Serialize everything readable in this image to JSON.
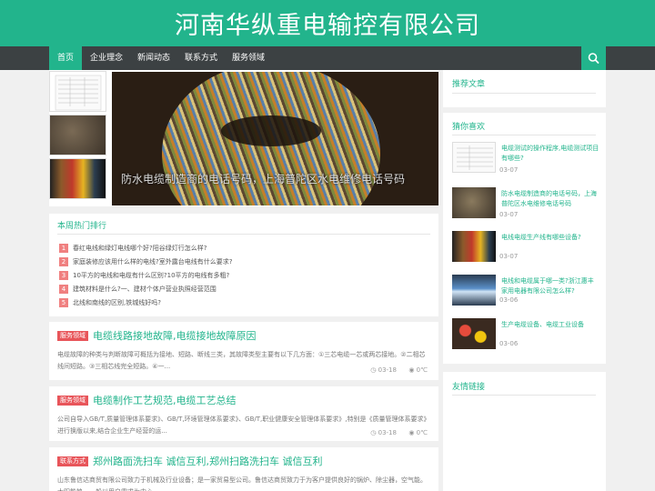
{
  "site": {
    "title": "河南华纵重电输控有限公司"
  },
  "nav": {
    "items": [
      "首页",
      "企业理念",
      "新闻动态",
      "联系方式",
      "服务领域"
    ],
    "search_icon": "search-icon"
  },
  "slider": {
    "caption": "防水电缆制造商的电话号码，上海普陀区水电维修电话号码"
  },
  "hot": {
    "title": "本周热门排行",
    "items": [
      {
        "num": "1",
        "text": "春红电线和绿灯电线哪个好?阳谷绿灯行怎么样?"
      },
      {
        "num": "2",
        "text": "家庭装修应该用什么样的电线?室外露台电线有什么要求?"
      },
      {
        "num": "3",
        "text": "10平方的电线和电缆有什么区别?10平方的电线有多粗?"
      },
      {
        "num": "4",
        "text": "建筑材料是什么?一、建材个体户营业执照经营范围"
      },
      {
        "num": "5",
        "text": "北线和南线的区别,铁城线好吗?"
      }
    ]
  },
  "posts": [
    {
      "category": "服务领域",
      "title": "电缆线路接地故障,电缆接地故障原因",
      "excerpt": "电缆故障的种类与判断故障可概括为接地、短路、断线三类，其故障类型主要有以下几方面：①三芯电缆一芯或两芯接地。②二相芯线间短路。③三相芯线完全短路。④一...",
      "date": "03-18",
      "views": "0℃"
    },
    {
      "category": "服务领域",
      "title": "电缆制作工艺规范,电缆工艺总结",
      "excerpt": "公司自导入GB/T,质量管理体系要求》、GB/T,环境管理体系要求》、GB/T,职业健康安全管理体系要求》,特别是《质量管理体系要求》进行换版以来,结合企业生产经营的运...",
      "date": "03-18",
      "views": "0℃"
    },
    {
      "category": "联系方式",
      "title": "郑州路面洗扫车 诚信互利,郑州扫路洗扫车 诚信互利",
      "excerpt": "山东鲁信达商贸有限公司致力于机械及行业设备；是一家贸易型公司。鲁信达商贸致力于为客户提供良好的锅炉、除尘器，空气能。太阳能热，一般以用户需求为中心，"
    }
  ],
  "sidebar": {
    "recommended_title": "推荐文章",
    "guess_title": "猜你喜欢",
    "links_title": "友情链接",
    "guess_items": [
      {
        "text": "电缆测试的操作程序,电缆测试项目有哪些?",
        "date": "03-07"
      },
      {
        "text": "防水电缆制造商的电话号码，上海普陀区水电维修电话号码",
        "date": "03-07"
      },
      {
        "text": "电线电缆生产线有哪些设备?",
        "date": "03-07"
      },
      {
        "text": "电线和电缆属于哪一类?浙江惠丰家用电器有限公司怎么样?",
        "date": "03-06"
      },
      {
        "text": "生产电缆设备、电缆工业设备",
        "date": "03-06"
      }
    ]
  },
  "colors": {
    "accent": "#22b48c",
    "nav_bg": "#3c4143",
    "badge": "#e8555a",
    "hot_num": "#f08080"
  }
}
